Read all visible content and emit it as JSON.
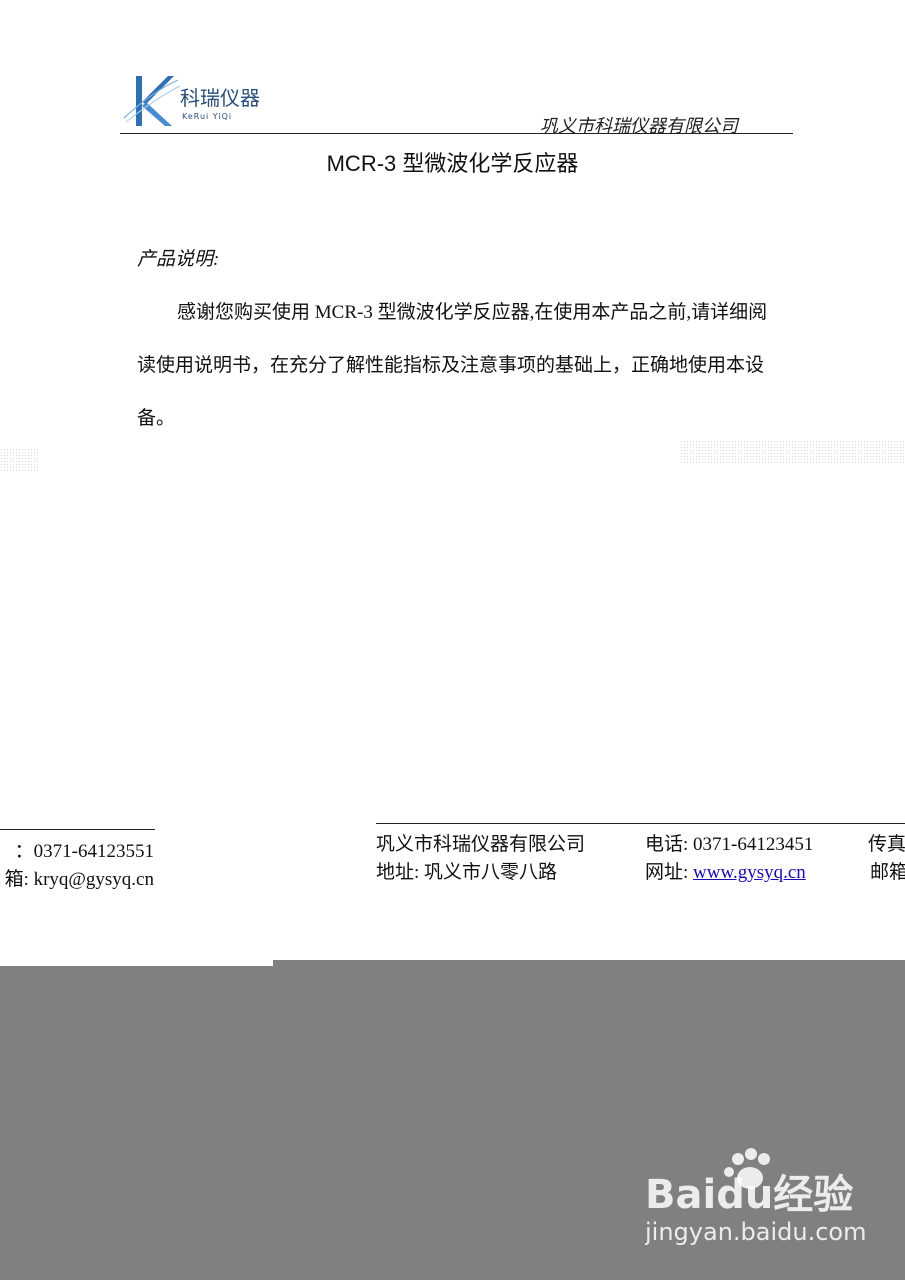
{
  "logo": {
    "name_cn": "科瑞仪器",
    "name_en": "KeRui YiQi"
  },
  "header": {
    "company": "巩义市科瑞仪器有限公司"
  },
  "document": {
    "title": "MCR-3 型微波化学反应器",
    "section_heading": "产品说明:",
    "paragraph": "感谢您购买使用 MCR-3 型微波化学反应器,在使用本产品之前,请详细阅读使用说明书，在充分了解性能指标及注意事项的基础上，正确地使用本设备。"
  },
  "footer_left": {
    "fax_fragment": "：0371-64123551",
    "email_fragment": "箱: kryq@gysyq.cn"
  },
  "footer_right": {
    "company": "巩义市科瑞仪器有限公司",
    "phone": "电话: 0371-64123451",
    "fax_cut": "传真",
    "address": "地址: 巩义市八零八路",
    "website_label": "网址: ",
    "website": "www.gysyq.cn",
    "email_cut": "邮箱"
  },
  "watermark": {
    "brand": "Baidu经验",
    "url": "jingyan.baidu.com"
  }
}
